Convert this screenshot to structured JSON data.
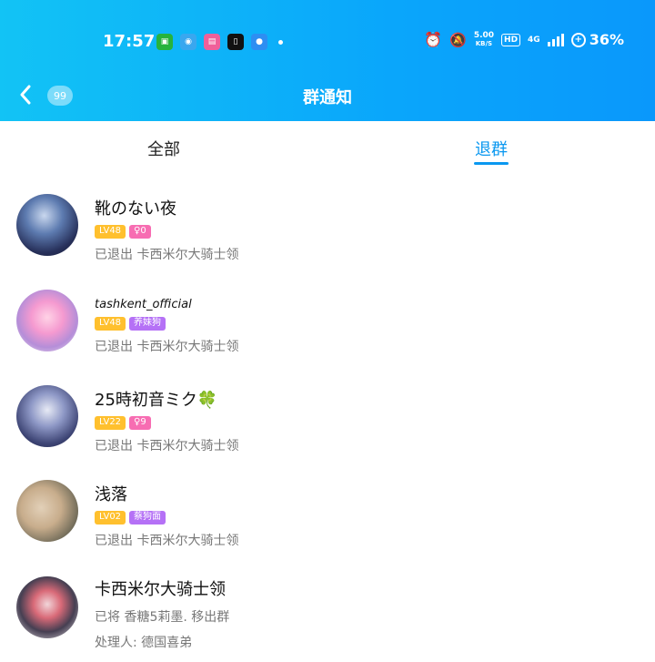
{
  "status_bar": {
    "time": "17:57",
    "speed_value": "5.00",
    "speed_unit": "KB/S",
    "hd": "HD",
    "net": "4G",
    "battery": "36%"
  },
  "nav": {
    "badge": "99",
    "title": "群通知"
  },
  "tabs": [
    {
      "label": "全部"
    },
    {
      "label": "退群"
    }
  ],
  "items": [
    {
      "name": "靴のない夜",
      "level": "LV48",
      "tag2": "♀0",
      "desc": "已退出 卡西米尔大骑士领"
    },
    {
      "name": "tashkent_official",
      "level": "LV48",
      "tag2": "养妹狗",
      "desc": "已退出 卡西米尔大骑士领"
    },
    {
      "name": "25時初音ミク🍀",
      "level": "LV22",
      "tag2": "♀9",
      "desc": "已退出 卡西米尔大骑士领"
    },
    {
      "name": "浅落",
      "level": "LV02",
      "tag2": "蔡狗面",
      "desc": "已退出 卡西米尔大骑士领"
    },
    {
      "name": "卡西米尔大骑士领",
      "line1": "已将 香糖5莉墨. 移出群",
      "line2": "处理人: 德国喜弟"
    }
  ],
  "colors": {
    "accent": "#0a98f0",
    "level_tag": "#ffc02e",
    "pink_tag": "#f76db2",
    "purple_tag": "#b571f6"
  }
}
